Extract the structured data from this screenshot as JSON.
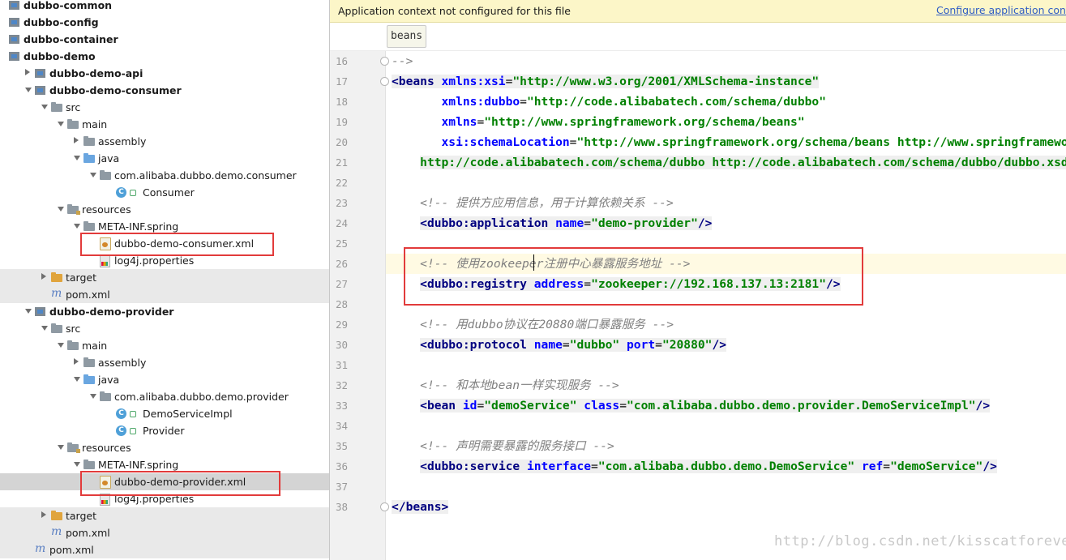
{
  "tree": {
    "items": [
      {
        "label": "dubbo-common",
        "kind": "module",
        "bold": true,
        "arrow": "none"
      },
      {
        "label": "dubbo-config",
        "kind": "module",
        "bold": true,
        "arrow": "none"
      },
      {
        "label": "dubbo-container",
        "kind": "module",
        "bold": true,
        "arrow": "none"
      },
      {
        "label": "dubbo-demo",
        "kind": "module",
        "bold": true,
        "arrow": "none"
      },
      {
        "label": "dubbo-demo-api",
        "kind": "module",
        "bold": true,
        "arrow": "closed"
      },
      {
        "label": "dubbo-demo-consumer",
        "kind": "module",
        "bold": true,
        "arrow": "open"
      },
      {
        "label": "src",
        "kind": "folder",
        "arrow": "open"
      },
      {
        "label": "main",
        "kind": "folder",
        "arrow": "open"
      },
      {
        "label": "assembly",
        "kind": "folder",
        "arrow": "closed"
      },
      {
        "label": "java",
        "kind": "folder-blue",
        "arrow": "open"
      },
      {
        "label": "com.alibaba.dubbo.demo.consumer",
        "kind": "folder",
        "arrow": "open"
      },
      {
        "label": "Consumer",
        "kind": "class",
        "arrow": "none"
      },
      {
        "label": "resources",
        "kind": "folder-res",
        "arrow": "open"
      },
      {
        "label": "META-INF.spring",
        "kind": "folder",
        "arrow": "open"
      },
      {
        "label": "dubbo-demo-consumer.xml",
        "kind": "xml",
        "arrow": "none"
      },
      {
        "label": "log4j.properties",
        "kind": "props",
        "arrow": "none"
      },
      {
        "label": "target",
        "kind": "folder-orange",
        "arrow": "closed"
      },
      {
        "label": "pom.xml",
        "kind": "maven",
        "arrow": "none"
      },
      {
        "label": "dubbo-demo-provider",
        "kind": "module",
        "bold": true,
        "arrow": "open"
      },
      {
        "label": "src",
        "kind": "folder",
        "arrow": "open"
      },
      {
        "label": "main",
        "kind": "folder",
        "arrow": "open"
      },
      {
        "label": "assembly",
        "kind": "folder",
        "arrow": "closed"
      },
      {
        "label": "java",
        "kind": "folder-blue",
        "arrow": "open"
      },
      {
        "label": "com.alibaba.dubbo.demo.provider",
        "kind": "folder",
        "arrow": "open"
      },
      {
        "label": "DemoServiceImpl",
        "kind": "class",
        "arrow": "none"
      },
      {
        "label": "Provider",
        "kind": "class",
        "arrow": "none"
      },
      {
        "label": "resources",
        "kind": "folder-res",
        "arrow": "open"
      },
      {
        "label": "META-INF.spring",
        "kind": "folder",
        "arrow": "open"
      },
      {
        "label": "dubbo-demo-provider.xml",
        "kind": "xml",
        "arrow": "none",
        "selected": true
      },
      {
        "label": "log4j.properties",
        "kind": "props",
        "arrow": "none"
      },
      {
        "label": "target",
        "kind": "folder-orange",
        "arrow": "closed"
      },
      {
        "label": "pom.xml",
        "kind": "maven",
        "arrow": "none"
      },
      {
        "label": "pom.xml",
        "kind": "maven",
        "arrow": "none"
      }
    ]
  },
  "editor": {
    "banner_text": "Application context not configured for this file",
    "banner_link": "Configure application conte",
    "breadcrumb": "beans",
    "watermark": "http://blog.csdn.net/kisscatforever",
    "caret_line_number": "26",
    "lines": [
      {
        "n": "16",
        "segs": [
          [
            "-->",
            "cm"
          ]
        ]
      },
      {
        "n": "17",
        "segs": [
          [
            "<",
            "tg"
          ],
          [
            "beans ",
            "tg"
          ],
          [
            "xmlns:xsi",
            "at"
          ],
          [
            "=",
            "p"
          ],
          [
            "\"http://www.w3.org/2001/XMLSchema-instance\"",
            "vl"
          ]
        ]
      },
      {
        "n": "18",
        "segs": [
          [
            "       ",
            "p"
          ],
          [
            "xmlns:dubbo",
            "at"
          ],
          [
            "=",
            "p"
          ],
          [
            "\"http://code.alibabatech.com/schema/dubbo\"",
            "vl"
          ]
        ]
      },
      {
        "n": "19",
        "segs": [
          [
            "       ",
            "p"
          ],
          [
            "xmlns",
            "at"
          ],
          [
            "=",
            "p"
          ],
          [
            "\"http://www.springframework.org/schema/beans\"",
            "vl"
          ]
        ]
      },
      {
        "n": "20",
        "segs": [
          [
            "       ",
            "p"
          ],
          [
            "xsi:schemaLocation",
            "at"
          ],
          [
            "=",
            "p"
          ],
          [
            "\"http://www.springframework.org/schema/beans http://www.springframework.org/schema/beans/spring-beans.xsd",
            "vl"
          ]
        ]
      },
      {
        "n": "21",
        "segs": [
          [
            "    ",
            "p"
          ],
          [
            "http://code.alibabatech.com/schema/dubbo http://code.alibabatech.com/schema/dubbo/dubbo.xsd\"",
            "vl"
          ],
          [
            ">",
            "tg"
          ]
        ]
      },
      {
        "n": "22",
        "segs": []
      },
      {
        "n": "23",
        "segs": [
          [
            "    ",
            "p"
          ],
          [
            "<!-- 提供方应用信息，用于计算依赖关系 -->",
            "cm"
          ]
        ]
      },
      {
        "n": "24",
        "segs": [
          [
            "    ",
            "p"
          ],
          [
            "<",
            "tg"
          ],
          [
            "dubbo:application ",
            "tg"
          ],
          [
            "name",
            "at"
          ],
          [
            "=",
            "p"
          ],
          [
            "\"demo-provider\"",
            "vl"
          ],
          [
            "/>",
            "tg"
          ]
        ]
      },
      {
        "n": "25",
        "segs": []
      },
      {
        "n": "26",
        "segs": [
          [
            "    ",
            "p"
          ],
          [
            "<!-- 使用zookeeper注册中心暴露服务地址 -->",
            "cm"
          ]
        ]
      },
      {
        "n": "27",
        "segs": [
          [
            "    ",
            "p"
          ],
          [
            "<",
            "tg"
          ],
          [
            "dubbo:registry ",
            "tg"
          ],
          [
            "address",
            "at"
          ],
          [
            "=",
            "p"
          ],
          [
            "\"zookeeper://192.168.137.13:2181\"",
            "vl"
          ],
          [
            "/>",
            "tg"
          ]
        ]
      },
      {
        "n": "28",
        "segs": []
      },
      {
        "n": "29",
        "segs": [
          [
            "    ",
            "p"
          ],
          [
            "<!-- 用dubbo协议在20880端口暴露服务 -->",
            "cm"
          ]
        ]
      },
      {
        "n": "30",
        "segs": [
          [
            "    ",
            "p"
          ],
          [
            "<",
            "tg"
          ],
          [
            "dubbo:protocol ",
            "tg"
          ],
          [
            "name",
            "at"
          ],
          [
            "=",
            "p"
          ],
          [
            "\"dubbo\" ",
            "vl"
          ],
          [
            "port",
            "at"
          ],
          [
            "=",
            "p"
          ],
          [
            "\"20880\"",
            "vl"
          ],
          [
            "/>",
            "tg"
          ]
        ]
      },
      {
        "n": "31",
        "segs": []
      },
      {
        "n": "32",
        "segs": [
          [
            "    ",
            "p"
          ],
          [
            "<!-- 和本地bean一样实现服务 -->",
            "cm"
          ]
        ]
      },
      {
        "n": "33",
        "segs": [
          [
            "    ",
            "p"
          ],
          [
            "<",
            "tg"
          ],
          [
            "bean ",
            "tg"
          ],
          [
            "id",
            "at"
          ],
          [
            "=",
            "p"
          ],
          [
            "\"demoService\" ",
            "vl"
          ],
          [
            "class",
            "at"
          ],
          [
            "=",
            "p"
          ],
          [
            "\"com.alibaba.dubbo.demo.provider.DemoServiceImpl\"",
            "vl"
          ],
          [
            "/>",
            "tg"
          ]
        ]
      },
      {
        "n": "34",
        "segs": []
      },
      {
        "n": "35",
        "segs": [
          [
            "    ",
            "p"
          ],
          [
            "<!-- 声明需要暴露的服务接口 -->",
            "cm"
          ]
        ]
      },
      {
        "n": "36",
        "segs": [
          [
            "    ",
            "p"
          ],
          [
            "<",
            "tg"
          ],
          [
            "dubbo:service ",
            "tg"
          ],
          [
            "interface",
            "at"
          ],
          [
            "=",
            "p"
          ],
          [
            "\"com.alibaba.dubbo.demo.DemoService\" ",
            "vl"
          ],
          [
            "ref",
            "at"
          ],
          [
            "=",
            "p"
          ],
          [
            "\"demoService\"",
            "vl"
          ],
          [
            "/>",
            "tg"
          ]
        ]
      },
      {
        "n": "37",
        "segs": []
      },
      {
        "n": "38",
        "segs": [
          [
            "</",
            "tg"
          ],
          [
            "beans",
            "tg"
          ],
          [
            ">",
            "tg"
          ]
        ]
      }
    ]
  }
}
